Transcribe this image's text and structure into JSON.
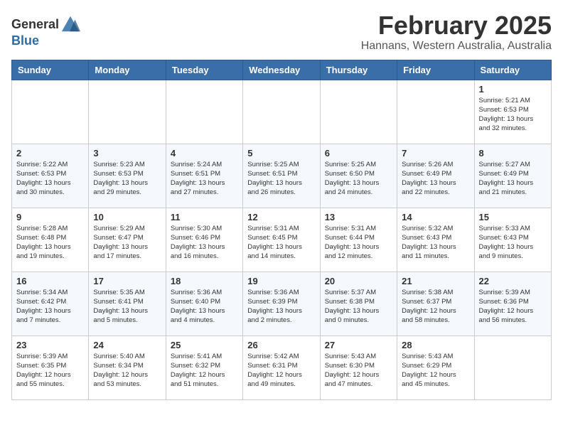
{
  "header": {
    "logo_general": "General",
    "logo_blue": "Blue",
    "title": "February 2025",
    "location": "Hannans, Western Australia, Australia"
  },
  "calendar": {
    "weekdays": [
      "Sunday",
      "Monday",
      "Tuesday",
      "Wednesday",
      "Thursday",
      "Friday",
      "Saturday"
    ],
    "weeks": [
      [
        {
          "day": "",
          "detail": ""
        },
        {
          "day": "",
          "detail": ""
        },
        {
          "day": "",
          "detail": ""
        },
        {
          "day": "",
          "detail": ""
        },
        {
          "day": "",
          "detail": ""
        },
        {
          "day": "",
          "detail": ""
        },
        {
          "day": "1",
          "detail": "Sunrise: 5:21 AM\nSunset: 6:53 PM\nDaylight: 13 hours\nand 32 minutes."
        }
      ],
      [
        {
          "day": "2",
          "detail": "Sunrise: 5:22 AM\nSunset: 6:53 PM\nDaylight: 13 hours\nand 30 minutes."
        },
        {
          "day": "3",
          "detail": "Sunrise: 5:23 AM\nSunset: 6:53 PM\nDaylight: 13 hours\nand 29 minutes."
        },
        {
          "day": "4",
          "detail": "Sunrise: 5:24 AM\nSunset: 6:51 PM\nDaylight: 13 hours\nand 27 minutes."
        },
        {
          "day": "5",
          "detail": "Sunrise: 5:25 AM\nSunset: 6:51 PM\nDaylight: 13 hours\nand 26 minutes."
        },
        {
          "day": "6",
          "detail": "Sunrise: 5:25 AM\nSunset: 6:50 PM\nDaylight: 13 hours\nand 24 minutes."
        },
        {
          "day": "7",
          "detail": "Sunrise: 5:26 AM\nSunset: 6:49 PM\nDaylight: 13 hours\nand 22 minutes."
        },
        {
          "day": "8",
          "detail": "Sunrise: 5:27 AM\nSunset: 6:49 PM\nDaylight: 13 hours\nand 21 minutes."
        }
      ],
      [
        {
          "day": "9",
          "detail": "Sunrise: 5:28 AM\nSunset: 6:48 PM\nDaylight: 13 hours\nand 19 minutes."
        },
        {
          "day": "10",
          "detail": "Sunrise: 5:29 AM\nSunset: 6:47 PM\nDaylight: 13 hours\nand 17 minutes."
        },
        {
          "day": "11",
          "detail": "Sunrise: 5:30 AM\nSunset: 6:46 PM\nDaylight: 13 hours\nand 16 minutes."
        },
        {
          "day": "12",
          "detail": "Sunrise: 5:31 AM\nSunset: 6:45 PM\nDaylight: 13 hours\nand 14 minutes."
        },
        {
          "day": "13",
          "detail": "Sunrise: 5:31 AM\nSunset: 6:44 PM\nDaylight: 13 hours\nand 12 minutes."
        },
        {
          "day": "14",
          "detail": "Sunrise: 5:32 AM\nSunset: 6:43 PM\nDaylight: 13 hours\nand 11 minutes."
        },
        {
          "day": "15",
          "detail": "Sunrise: 5:33 AM\nSunset: 6:43 PM\nDaylight: 13 hours\nand 9 minutes."
        }
      ],
      [
        {
          "day": "16",
          "detail": "Sunrise: 5:34 AM\nSunset: 6:42 PM\nDaylight: 13 hours\nand 7 minutes."
        },
        {
          "day": "17",
          "detail": "Sunrise: 5:35 AM\nSunset: 6:41 PM\nDaylight: 13 hours\nand 5 minutes."
        },
        {
          "day": "18",
          "detail": "Sunrise: 5:36 AM\nSunset: 6:40 PM\nDaylight: 13 hours\nand 4 minutes."
        },
        {
          "day": "19",
          "detail": "Sunrise: 5:36 AM\nSunset: 6:39 PM\nDaylight: 13 hours\nand 2 minutes."
        },
        {
          "day": "20",
          "detail": "Sunrise: 5:37 AM\nSunset: 6:38 PM\nDaylight: 13 hours\nand 0 minutes."
        },
        {
          "day": "21",
          "detail": "Sunrise: 5:38 AM\nSunset: 6:37 PM\nDaylight: 12 hours\nand 58 minutes."
        },
        {
          "day": "22",
          "detail": "Sunrise: 5:39 AM\nSunset: 6:36 PM\nDaylight: 12 hours\nand 56 minutes."
        }
      ],
      [
        {
          "day": "23",
          "detail": "Sunrise: 5:39 AM\nSunset: 6:35 PM\nDaylight: 12 hours\nand 55 minutes."
        },
        {
          "day": "24",
          "detail": "Sunrise: 5:40 AM\nSunset: 6:34 PM\nDaylight: 12 hours\nand 53 minutes."
        },
        {
          "day": "25",
          "detail": "Sunrise: 5:41 AM\nSunset: 6:32 PM\nDaylight: 12 hours\nand 51 minutes."
        },
        {
          "day": "26",
          "detail": "Sunrise: 5:42 AM\nSunset: 6:31 PM\nDaylight: 12 hours\nand 49 minutes."
        },
        {
          "day": "27",
          "detail": "Sunrise: 5:43 AM\nSunset: 6:30 PM\nDaylight: 12 hours\nand 47 minutes."
        },
        {
          "day": "28",
          "detail": "Sunrise: 5:43 AM\nSunset: 6:29 PM\nDaylight: 12 hours\nand 45 minutes."
        },
        {
          "day": "",
          "detail": ""
        }
      ]
    ]
  }
}
